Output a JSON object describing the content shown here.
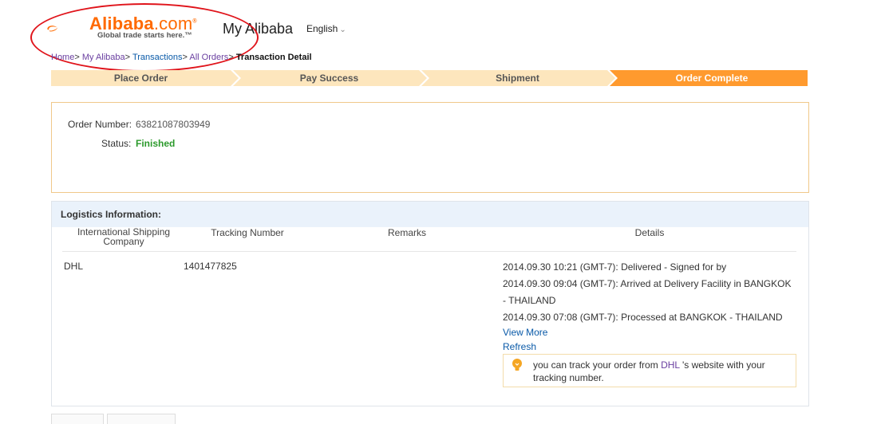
{
  "header": {
    "logo_word": "Alibaba",
    "logo_com": ".com",
    "logo_tagline": "Global trade starts here.™",
    "my_alibaba": "My Alibaba",
    "language": "English"
  },
  "breadcrumb": {
    "home": "Home",
    "my_alibaba": "My Alibaba",
    "transactions": "Transactions",
    "all_orders": "All Orders",
    "current": "Transaction Detail",
    "sep": ">"
  },
  "steps": [
    {
      "label": "Place Order",
      "state": "done"
    },
    {
      "label": "Pay Success",
      "state": "done"
    },
    {
      "label": "Shipment",
      "state": "done"
    },
    {
      "label": "Order Complete",
      "state": "active"
    }
  ],
  "colors": {
    "brand_orange": "#ff6a00",
    "step_done": "#fde6bd",
    "step_active": "#ff9a2e",
    "status_green": "#2c9a2c",
    "annotation_red": "#e0141b"
  },
  "order": {
    "number_label": "Order Number:",
    "number_value": "63821087803949",
    "status_label": "Status:",
    "status_value": "Finished"
  },
  "logistics": {
    "title": "Logistics Information:",
    "columns": {
      "company_1": "International Shipping",
      "company_2": "Company",
      "tracking": "Tracking Number",
      "remarks": "Remarks",
      "details": "Details"
    },
    "row": {
      "company": "DHL",
      "tracking_number": "1401477825",
      "details": [
        "2014.09.30 10:21 (GMT-7): Delivered - Signed for by",
        "2014.09.30 09:04 (GMT-7): Arrived at Delivery Facility in BANGKOK",
        "- THAILAND",
        "2014.09.30 07:08 (GMT-7): Processed at BANGKOK - THAILAND"
      ],
      "view_more": "View More",
      "refresh": "Refresh"
    },
    "tip": {
      "text_before": "you can track your order from ",
      "carrier_link": "DHL",
      "text_after": " 's website with your tracking number.",
      "icon": "lightbulb-icon"
    }
  }
}
